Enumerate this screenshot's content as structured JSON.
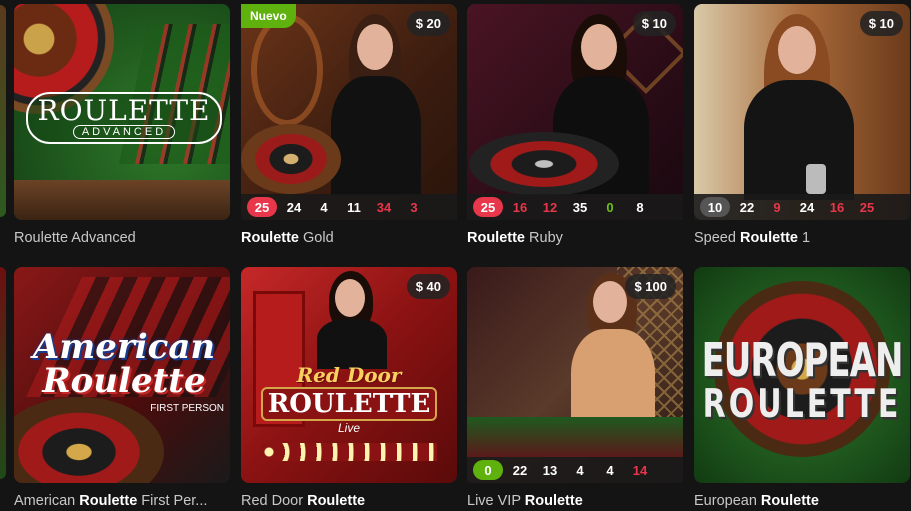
{
  "games": [
    {
      "id": "roulette-advanced",
      "name_light": "Roulette ",
      "name_bold": "",
      "name_tail": "Advanced",
      "logo": "ROULETTE",
      "logo_sub": "ADVANCED",
      "badge": null,
      "new": null,
      "results": []
    },
    {
      "id": "roulette-gold",
      "name_bold": "Roulette",
      "name_tail": " Gold",
      "badge": "$ 20",
      "new": "Nuevo",
      "results": [
        {
          "v": "25",
          "c": "red",
          "first": true
        },
        {
          "v": "24",
          "c": "black"
        },
        {
          "v": "4",
          "c": "black"
        },
        {
          "v": "11",
          "c": "black"
        },
        {
          "v": "34",
          "c": "red"
        },
        {
          "v": "3",
          "c": "red"
        }
      ]
    },
    {
      "id": "roulette-ruby",
      "name_bold": "Roulette",
      "name_tail": " Ruby",
      "badge": "$ 10",
      "new": null,
      "results": [
        {
          "v": "25",
          "c": "red",
          "first": true
        },
        {
          "v": "16",
          "c": "red"
        },
        {
          "v": "12",
          "c": "red"
        },
        {
          "v": "35",
          "c": "black"
        },
        {
          "v": "0",
          "c": "green"
        },
        {
          "v": "8",
          "c": "black"
        }
      ]
    },
    {
      "id": "speed-roulette-1",
      "name_light": "Speed ",
      "name_bold": "Roulette",
      "name_tail": " 1",
      "badge": "$ 10",
      "new": null,
      "results": [
        {
          "v": "10",
          "c": "black",
          "first": true
        },
        {
          "v": "22",
          "c": "black"
        },
        {
          "v": "9",
          "c": "red"
        },
        {
          "v": "24",
          "c": "black"
        },
        {
          "v": "16",
          "c": "red"
        },
        {
          "v": "25",
          "c": "red"
        }
      ]
    },
    {
      "id": "american-roulette-first-person",
      "name_light": "American ",
      "name_bold": "Roulette",
      "name_tail": " First Per...",
      "logo": "American",
      "logo2": "Roulette",
      "logo_sub": "FIRST PERSON",
      "badge": null,
      "new": null,
      "results": []
    },
    {
      "id": "red-door-roulette",
      "name_light": "Red Door ",
      "name_bold": "Roulette",
      "name_tail": "",
      "logo": "Red Door",
      "logo2": "ROULETTE",
      "logo_sub": "Live",
      "badge": "$ 40",
      "new": null,
      "results": []
    },
    {
      "id": "live-vip-roulette",
      "name_light": "Live VIP ",
      "name_bold": "Roulette",
      "name_tail": "",
      "badge": "$ 100",
      "new": null,
      "results": [
        {
          "v": "0",
          "c": "green",
          "first": true
        },
        {
          "v": "22",
          "c": "black"
        },
        {
          "v": "13",
          "c": "black"
        },
        {
          "v": "4",
          "c": "black"
        },
        {
          "v": "4",
          "c": "black"
        },
        {
          "v": "14",
          "c": "red"
        }
      ]
    },
    {
      "id": "european-roulette",
      "name_light": "European ",
      "name_bold": "Roulette",
      "name_tail": "",
      "logo": "EUROPEAN",
      "logo2": "ROULETTE",
      "badge": null,
      "new": null,
      "results": []
    }
  ],
  "colors": {
    "red": "#e8364a",
    "green": "#6fbe1a",
    "black_bg": "#3a3a3a",
    "red_first_bg": "#e8364a",
    "green_first_bg": "#5fb10e",
    "black_first_bg": "#555555"
  }
}
